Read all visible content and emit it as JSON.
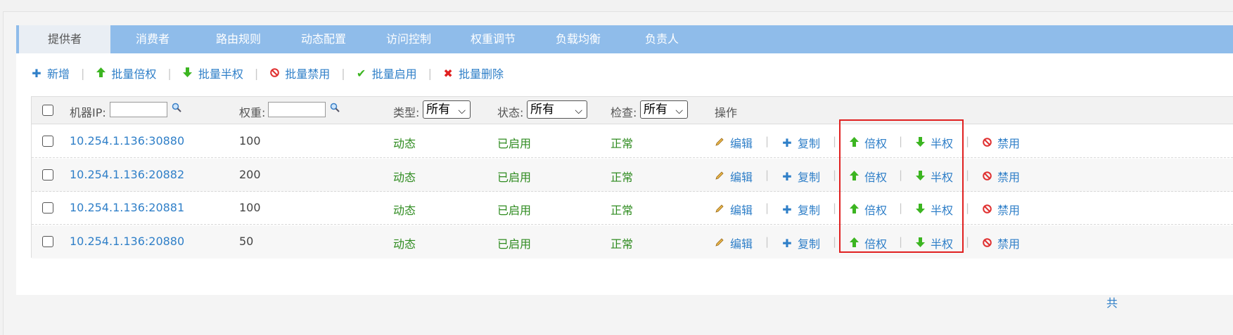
{
  "tabs": [
    {
      "label": "提供者",
      "active": true
    },
    {
      "label": "消费者"
    },
    {
      "label": "路由规则"
    },
    {
      "label": "动态配置"
    },
    {
      "label": "访问控制"
    },
    {
      "label": "权重调节"
    },
    {
      "label": "负载均衡"
    },
    {
      "label": "负责人"
    }
  ],
  "toolbar": {
    "add": "新增",
    "batch_double": "批量倍权",
    "batch_half": "批量半权",
    "batch_disable": "批量禁用",
    "batch_enable": "批量启用",
    "batch_delete": "批量删除"
  },
  "header": {
    "ip_label": "机器IP:",
    "weight_label": "权重:",
    "type_label": "类型:",
    "type_value": "所有",
    "status_label": "状态:",
    "status_value": "所有",
    "check_label": "检查:",
    "check_value": "所有",
    "ops_label": "操作"
  },
  "ops": {
    "edit": "编辑",
    "copy": "复制",
    "double": "倍权",
    "half": "半权",
    "disable": "禁用"
  },
  "rows": [
    {
      "ip": "10.254.1.136:30880",
      "weight": "100",
      "type": "动态",
      "status": "已启用",
      "check": "正常"
    },
    {
      "ip": "10.254.1.136:20882",
      "weight": "200",
      "type": "动态",
      "status": "已启用",
      "check": "正常"
    },
    {
      "ip": "10.254.1.136:20881",
      "weight": "100",
      "type": "动态",
      "status": "已启用",
      "check": "正常"
    },
    {
      "ip": "10.254.1.136:20880",
      "weight": "50",
      "type": "动态",
      "status": "已启用",
      "check": "正常"
    }
  ],
  "pager": {
    "total_prefix": "共"
  },
  "colors": {
    "tabbar": "#8fbcea",
    "link": "#2f7fc8",
    "status_green": "#2e8b1f",
    "highlight_box": "#e02020"
  },
  "icons": {
    "add": "plus-icon",
    "double": "arrow-up-green-icon",
    "half": "arrow-down-green-icon",
    "disable": "ban-icon",
    "enable": "check-icon",
    "delete": "cross-icon",
    "edit": "pencil-icon",
    "search": "magnifier-icon"
  }
}
